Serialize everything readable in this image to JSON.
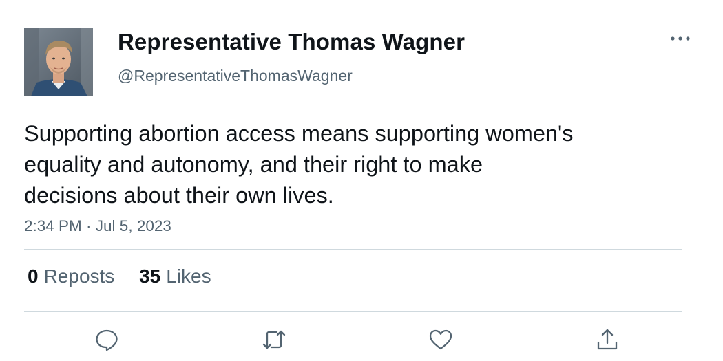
{
  "tweet": {
    "display_name": "Representative Thomas Wagner",
    "handle": "@RepresentativeThomasWagner",
    "text_lines": [
      "Supporting abortion access means supporting women's",
      "equality and autonomy, and their right to make",
      "decisions about their own lives."
    ],
    "timestamp": "2:34 PM · Jul 5, 2023",
    "stats": {
      "reposts_count": "0",
      "reposts_label": "Reposts",
      "likes_count": "35",
      "likes_label": "Likes"
    }
  },
  "icons": {
    "more": "more-horizontal-icon",
    "reply": "reply-icon",
    "repost": "repost-icon",
    "like": "heart-icon",
    "share": "share-icon"
  },
  "colors": {
    "text_primary": "#0f1419",
    "text_secondary": "#536471",
    "divider": "#cfd9de"
  }
}
